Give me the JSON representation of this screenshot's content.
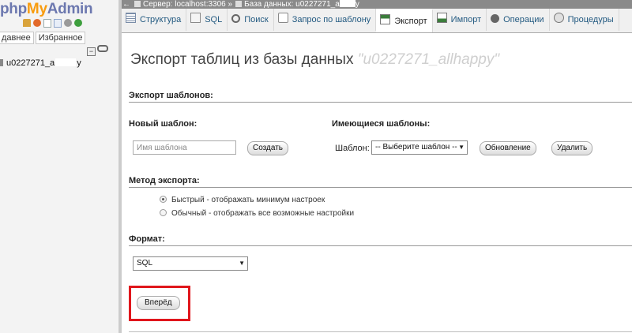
{
  "nav": {
    "logo": {
      "php": "php",
      "my": "My",
      "admin": "Admin"
    },
    "icons": [
      "home-icon",
      "exit-icon",
      "docs-icon",
      "sql-docs-icon",
      "settings-icon",
      "reload-icon"
    ],
    "tabs": [
      "давнее",
      "Избранное"
    ],
    "db_item": {
      "prefix": "u0227271_a",
      "suffix": "y"
    }
  },
  "serverbar": {
    "back": "←",
    "server": "Сервер: localhost:3306 »",
    "database": "База данных: u0227271_a",
    "database_suffix": "y"
  },
  "tabs": [
    {
      "label": "Структура",
      "icon": "structure-icon",
      "active": false
    },
    {
      "label": "SQL",
      "icon": "sql-icon",
      "active": false
    },
    {
      "label": "Поиск",
      "icon": "search-icon",
      "active": false
    },
    {
      "label": "Запрос по шаблону",
      "icon": "query-icon",
      "active": false
    },
    {
      "label": "Экспорт",
      "icon": "export-icon",
      "active": true
    },
    {
      "label": "Импорт",
      "icon": "import-icon",
      "active": false
    },
    {
      "label": "Операции",
      "icon": "operations-icon",
      "active": false
    },
    {
      "label": "Процедуры",
      "icon": "routines-icon",
      "active": false
    }
  ],
  "main": {
    "title": "Экспорт таблиц из базы данных",
    "title_db": "\"u0227271_allhappy\"",
    "templates": {
      "heading": "Экспорт шаблонов:",
      "new_label": "Новый шаблон:",
      "name_placeholder": "Имя шаблона",
      "create_button": "Создать",
      "existing_label": "Имеющиеся шаблоны:",
      "template_label": "Шаблон:",
      "template_select": "-- Выберите шаблон --",
      "update_button": "Обновление",
      "delete_button": "Удалить"
    },
    "method": {
      "heading": "Метод экспорта:",
      "quick": "Быстрый - отображать минимум настроек",
      "custom": "Обычный - отображать все возможные настройки",
      "selected": "quick"
    },
    "format": {
      "heading": "Формат:",
      "selected": "SQL"
    },
    "go_button": "Вперёд",
    "highlight_color": "#e0161c"
  }
}
